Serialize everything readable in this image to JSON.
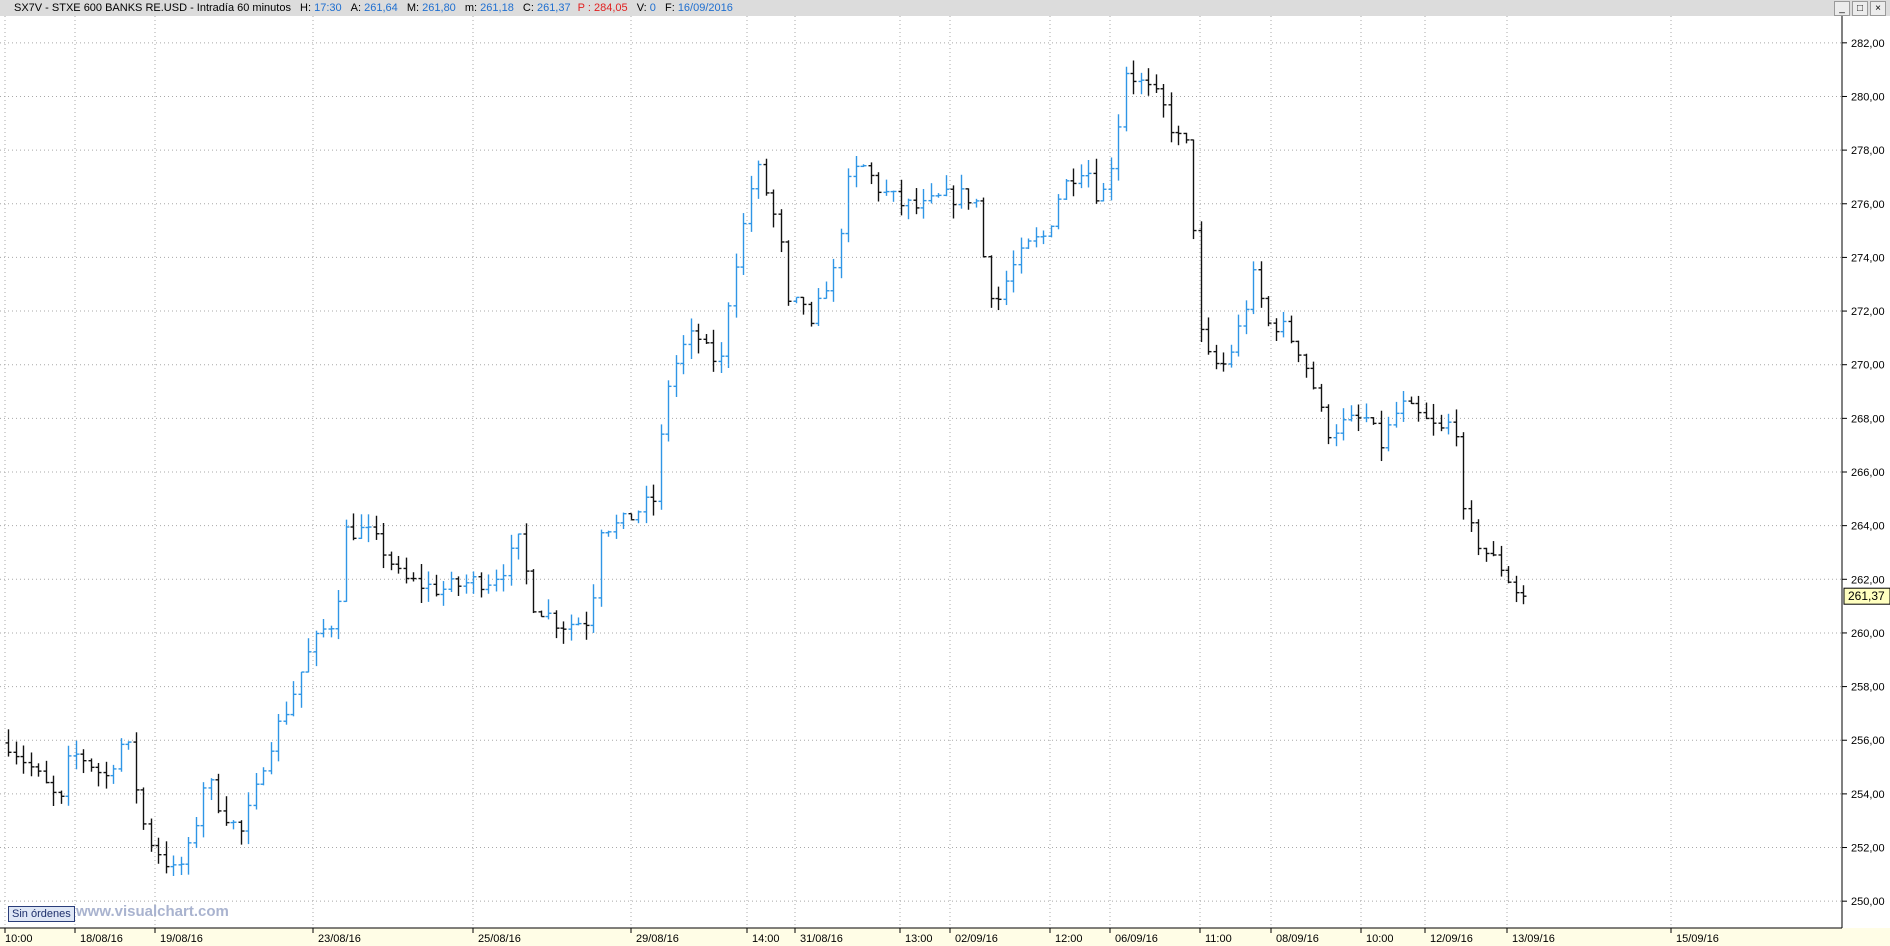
{
  "header": {
    "symbol": "SX7V - STXE 600 BANKS RE.USD - Intradía 60 minutos",
    "h_label": "H:",
    "h_value": "17:30",
    "a_label": "A:",
    "a_value": "261,64",
    "m_label": "M:",
    "m_value": "261,80",
    "lo_label": "m:",
    "lo_value": "261,18",
    "c_label": "C:",
    "c_value": "261,37",
    "p_label": "P :",
    "p_value": "284,05",
    "v_label": "V:",
    "v_value": "0",
    "f_label": "F:",
    "f_value": "16/09/2016"
  },
  "window_buttons": [
    "_",
    "□",
    "×"
  ],
  "orders_button": "Sin órdenes",
  "watermark": "www.visualchart.com",
  "colors": {
    "up": "#2f96e6",
    "down": "#111111",
    "grid": "#a8a8a8",
    "axis_bg": "#fffde6",
    "last_price_bg": "#ffffc0"
  },
  "chart_data": {
    "type": "ohlc",
    "interval": "60 minutos",
    "ylim": [
      249,
      283
    ],
    "y_ticks": [
      "250,00",
      "252,00",
      "254,00",
      "256,00",
      "258,00",
      "260,00",
      "262,00",
      "264,00",
      "266,00",
      "268,00",
      "270,00",
      "272,00",
      "274,00",
      "276,00",
      "278,00",
      "280,00",
      "282,00"
    ],
    "x_labels": [
      "10:00",
      "18/08/16",
      "19/08/16",
      "23/08/16",
      "25/08/16",
      "29/08/16",
      "14:00",
      "31/08/16",
      "13:00",
      "02/09/16",
      "12:00",
      "06/09/16",
      "11:00",
      "08/09/16",
      "10:00",
      "12/09/16",
      "13/09/16",
      "15/09/16"
    ],
    "last_price": "261,37",
    "anchors": [
      {
        "x": 8,
        "y": 255.9
      },
      {
        "x": 30,
        "y": 255.0
      },
      {
        "x": 60,
        "y": 253.6
      },
      {
        "x": 70,
        "y": 255.5
      },
      {
        "x": 85,
        "y": 255.3
      },
      {
        "x": 105,
        "y": 254.6
      },
      {
        "x": 125,
        "y": 256.2
      },
      {
        "x": 145,
        "y": 252.5
      },
      {
        "x": 175,
        "y": 251.0
      },
      {
        "x": 190,
        "y": 252.0
      },
      {
        "x": 205,
        "y": 254.7
      },
      {
        "x": 220,
        "y": 253.5
      },
      {
        "x": 240,
        "y": 252.5
      },
      {
        "x": 255,
        "y": 254.0
      },
      {
        "x": 265,
        "y": 255.5
      },
      {
        "x": 290,
        "y": 257.5
      },
      {
        "x": 305,
        "y": 259.0
      },
      {
        "x": 320,
        "y": 260.0
      },
      {
        "x": 335,
        "y": 260.5
      },
      {
        "x": 345,
        "y": 263.8
      },
      {
        "x": 365,
        "y": 263.8
      },
      {
        "x": 385,
        "y": 263.0
      },
      {
        "x": 400,
        "y": 262.0
      },
      {
        "x": 440,
        "y": 261.6
      },
      {
        "x": 470,
        "y": 261.9
      },
      {
        "x": 490,
        "y": 262.0
      },
      {
        "x": 505,
        "y": 262.5
      },
      {
        "x": 520,
        "y": 263.5
      },
      {
        "x": 530,
        "y": 261.2
      },
      {
        "x": 560,
        "y": 260.3
      },
      {
        "x": 590,
        "y": 260.5
      },
      {
        "x": 600,
        "y": 264.0
      },
      {
        "x": 620,
        "y": 264.0
      },
      {
        "x": 635,
        "y": 264.5
      },
      {
        "x": 655,
        "y": 265.0
      },
      {
        "x": 665,
        "y": 269.0
      },
      {
        "x": 680,
        "y": 270.5
      },
      {
        "x": 695,
        "y": 271.2
      },
      {
        "x": 705,
        "y": 270.5
      },
      {
        "x": 720,
        "y": 270.0
      },
      {
        "x": 730,
        "y": 273.0
      },
      {
        "x": 745,
        "y": 275.5
      },
      {
        "x": 755,
        "y": 277.5
      },
      {
        "x": 770,
        "y": 276.0
      },
      {
        "x": 780,
        "y": 274.5
      },
      {
        "x": 790,
        "y": 271.5
      },
      {
        "x": 800,
        "y": 272.8
      },
      {
        "x": 810,
        "y": 271.2
      },
      {
        "x": 825,
        "y": 273.0
      },
      {
        "x": 835,
        "y": 273.5
      },
      {
        "x": 845,
        "y": 276.5
      },
      {
        "x": 860,
        "y": 277.5
      },
      {
        "x": 880,
        "y": 276.5
      },
      {
        "x": 900,
        "y": 276.0
      },
      {
        "x": 920,
        "y": 275.8
      },
      {
        "x": 940,
        "y": 276.2
      },
      {
        "x": 960,
        "y": 276.3
      },
      {
        "x": 975,
        "y": 276.2
      },
      {
        "x": 985,
        "y": 273.5
      },
      {
        "x": 995,
        "y": 272.2
      },
      {
        "x": 1010,
        "y": 273.5
      },
      {
        "x": 1030,
        "y": 274.5
      },
      {
        "x": 1045,
        "y": 274.8
      },
      {
        "x": 1060,
        "y": 276.5
      },
      {
        "x": 1075,
        "y": 277.2
      },
      {
        "x": 1085,
        "y": 277.5
      },
      {
        "x": 1100,
        "y": 276.0
      },
      {
        "x": 1115,
        "y": 278.2
      },
      {
        "x": 1125,
        "y": 281.0
      },
      {
        "x": 1140,
        "y": 280.5
      },
      {
        "x": 1160,
        "y": 279.8
      },
      {
        "x": 1175,
        "y": 278.5
      },
      {
        "x": 1190,
        "y": 278.0
      },
      {
        "x": 1197,
        "y": 271.5
      },
      {
        "x": 1210,
        "y": 270.0
      },
      {
        "x": 1225,
        "y": 270.0
      },
      {
        "x": 1240,
        "y": 271.5
      },
      {
        "x": 1255,
        "y": 273.5
      },
      {
        "x": 1265,
        "y": 271.5
      },
      {
        "x": 1280,
        "y": 271.5
      },
      {
        "x": 1300,
        "y": 270.5
      },
      {
        "x": 1315,
        "y": 269.0
      },
      {
        "x": 1325,
        "y": 267.5
      },
      {
        "x": 1345,
        "y": 267.8
      },
      {
        "x": 1365,
        "y": 268.0
      },
      {
        "x": 1380,
        "y": 267.0
      },
      {
        "x": 1400,
        "y": 268.5
      },
      {
        "x": 1420,
        "y": 268.0
      },
      {
        "x": 1440,
        "y": 267.5
      },
      {
        "x": 1455,
        "y": 268.0
      },
      {
        "x": 1460,
        "y": 264.5
      },
      {
        "x": 1475,
        "y": 263.5
      },
      {
        "x": 1490,
        "y": 262.8
      },
      {
        "x": 1500,
        "y": 262.5
      },
      {
        "x": 1515,
        "y": 261.6
      },
      {
        "x": 1530,
        "y": 261.37
      }
    ]
  }
}
